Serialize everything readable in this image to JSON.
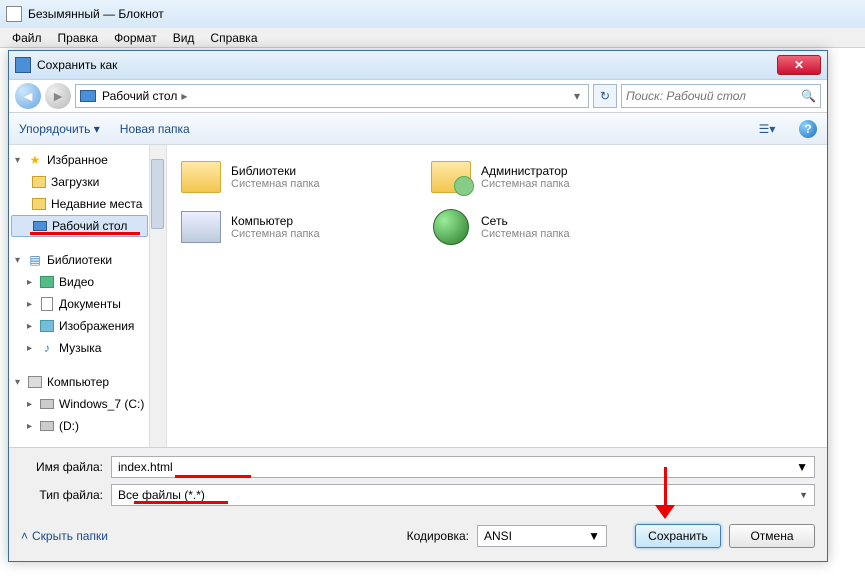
{
  "main": {
    "title": "Безымянный — Блокнот"
  },
  "menu": {
    "file": "Файл",
    "edit": "Правка",
    "format": "Формат",
    "view": "Вид",
    "help": "Справка"
  },
  "dlg": {
    "title": "Сохранить как",
    "addr": {
      "location": "Рабочий стол",
      "sep": "▸"
    },
    "search_placeholder": "Поиск: Рабочий стол",
    "toolbar": {
      "organize": "Упорядочить",
      "newfolder": "Новая папка"
    },
    "tree": {
      "fav": "Избранное",
      "downloads": "Загрузки",
      "recent": "Недавние места",
      "desktop": "Рабочий стол",
      "libs": "Библиотеки",
      "video": "Видео",
      "docs": "Документы",
      "pics": "Изображения",
      "music": "Музыка",
      "computer": "Компьютер",
      "c": "Windows_7 (C:)",
      "d": "(D:)"
    },
    "content": {
      "libs": {
        "name": "Библиотеки",
        "sub": "Системная папка"
      },
      "admin": {
        "name": "Администратор",
        "sub": "Системная папка"
      },
      "comp": {
        "name": "Компьютер",
        "sub": "Системная папка"
      },
      "net": {
        "name": "Сеть",
        "sub": "Системная папка"
      }
    },
    "labels": {
      "filename": "Имя файла:",
      "filetype": "Тип файла:",
      "encoding": "Кодировка:",
      "hide": "Скрыть папки"
    },
    "values": {
      "filename": "index.html",
      "filetype": "Все файлы  (*.*)",
      "encoding": "ANSI"
    },
    "buttons": {
      "save": "Сохранить",
      "cancel": "Отмена"
    }
  }
}
